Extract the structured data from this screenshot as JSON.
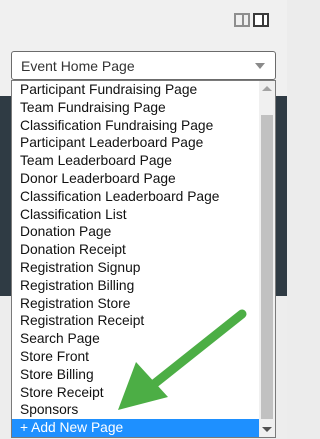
{
  "colors": {
    "accent_selected": "#1e90ff",
    "arrow": "#4cae45",
    "dark_panel": "#2f3b44"
  },
  "layout_toggle": {
    "split_icon": "split-view-icon",
    "full_icon": "full-view-icon"
  },
  "page_select": {
    "value": "Event Home Page",
    "caret_icon": "chevron-down-icon"
  },
  "dropdown": {
    "options": [
      "Participant Fundraising Page",
      "Team Fundraising Page",
      "Classification Fundraising Page",
      "Participant Leaderboard Page",
      "Team Leaderboard Page",
      "Donor Leaderboard Page",
      "Classification Leaderboard Page",
      "Classification List",
      "Donation Page",
      "Donation Receipt",
      "Registration Signup",
      "Registration Billing",
      "Registration Store",
      "Registration Receipt",
      "Search Page",
      "Store Front",
      "Store Billing",
      "Store Receipt",
      "Sponsors",
      "+ Add New Page"
    ],
    "selected_index": 19
  },
  "annotation": {
    "icon": "arrow-pointer-icon"
  }
}
